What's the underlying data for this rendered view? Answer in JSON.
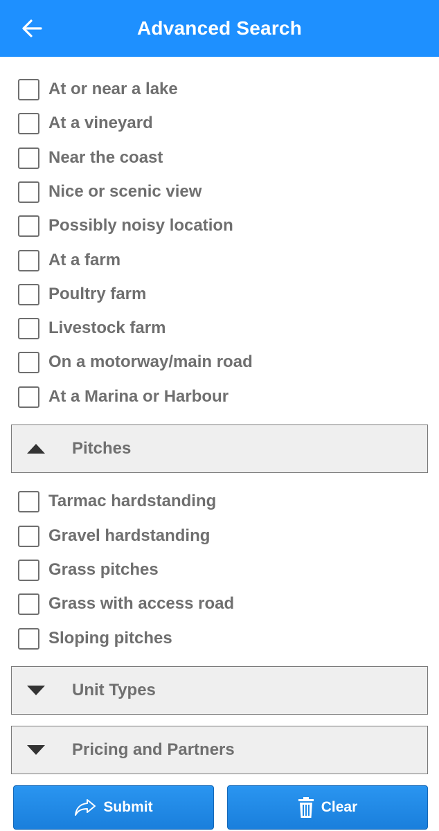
{
  "header": {
    "title": "Advanced Search",
    "back_icon": "arrow-left-icon",
    "color": "#1e90ff"
  },
  "location_options": [
    {
      "label": "At or near a lake",
      "checked": false
    },
    {
      "label": "At a vineyard",
      "checked": false
    },
    {
      "label": "Near the coast",
      "checked": false
    },
    {
      "label": "Nice or scenic view",
      "checked": false
    },
    {
      "label": "Possibly noisy location",
      "checked": false
    },
    {
      "label": "At a farm",
      "checked": false
    },
    {
      "label": "Poultry farm",
      "checked": false
    },
    {
      "label": "Livestock farm",
      "checked": false
    },
    {
      "label": "On a motorway/main road",
      "checked": false
    },
    {
      "label": "At a Marina or Harbour",
      "checked": false
    }
  ],
  "sections": {
    "pitches": {
      "label": "Pitches",
      "expanded": true,
      "icon": "triangle-up-icon"
    },
    "unit_types": {
      "label": "Unit Types",
      "expanded": false,
      "icon": "triangle-down-icon"
    },
    "pricing": {
      "label": "Pricing and Partners",
      "expanded": false,
      "icon": "triangle-down-icon"
    }
  },
  "pitch_options": [
    {
      "label": "Tarmac hardstanding",
      "checked": false
    },
    {
      "label": "Gravel hardstanding",
      "checked": false
    },
    {
      "label": "Grass pitches",
      "checked": false
    },
    {
      "label": "Grass with access road",
      "checked": false
    },
    {
      "label": "Sloping pitches",
      "checked": false
    }
  ],
  "actions": {
    "submit_label": "Submit",
    "submit_icon": "share-arrow-icon",
    "clear_label": "Clear",
    "clear_icon": "trash-icon",
    "button_color": "#1e88e5"
  }
}
